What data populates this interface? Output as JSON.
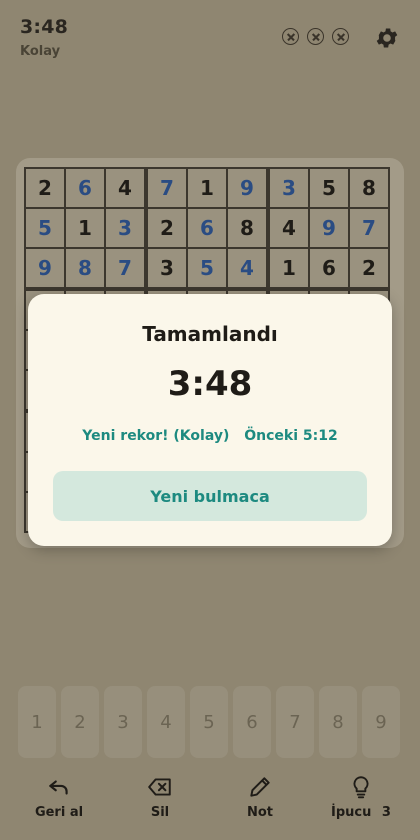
{
  "header": {
    "timer": "3:48",
    "difficulty": "Kolay",
    "mistakes_icon": "circle-x-icon",
    "settings_icon": "gear-icon"
  },
  "board": {
    "visible_rows": [
      [
        {
          "v": "2",
          "given": true
        },
        {
          "v": "6",
          "given": false
        },
        {
          "v": "4",
          "given": true
        },
        {
          "v": "7",
          "given": false
        },
        {
          "v": "1",
          "given": true
        },
        {
          "v": "9",
          "given": false
        },
        {
          "v": "3",
          "given": false
        },
        {
          "v": "5",
          "given": true
        },
        {
          "v": "8",
          "given": true
        }
      ],
      [
        {
          "v": "5",
          "given": false
        },
        {
          "v": "1",
          "given": true
        },
        {
          "v": "3",
          "given": false
        },
        {
          "v": "2",
          "given": true
        },
        {
          "v": "6",
          "given": false
        },
        {
          "v": "8",
          "given": true
        },
        {
          "v": "4",
          "given": true
        },
        {
          "v": "9",
          "given": false
        },
        {
          "v": "7",
          "given": false
        }
      ],
      [
        {
          "v": "9",
          "given": false
        },
        {
          "v": "8",
          "given": false
        },
        {
          "v": "7",
          "given": false
        },
        {
          "v": "3",
          "given": true
        },
        {
          "v": "5",
          "given": false
        },
        {
          "v": "4",
          "given": false
        },
        {
          "v": "1",
          "given": true
        },
        {
          "v": "6",
          "given": true
        },
        {
          "v": "2",
          "given": true
        }
      ]
    ],
    "given_color": "#1f1c17",
    "filled_color": "#2a4c83"
  },
  "dialog": {
    "title": "Tamamlandı",
    "time": "3:48",
    "record_text": "Yeni rekor! (Kolay)",
    "previous_text": "Önceki 5:12",
    "new_puzzle_label": "Yeni bulmaca",
    "accent_color": "#1d8a80"
  },
  "numpad": {
    "keys": [
      "1",
      "2",
      "3",
      "4",
      "5",
      "6",
      "7",
      "8",
      "9"
    ]
  },
  "toolbar": {
    "undo_label": "Geri al",
    "erase_label": "Sil",
    "note_label": "Not",
    "hint_label": "İpucu",
    "hint_count": "3"
  }
}
